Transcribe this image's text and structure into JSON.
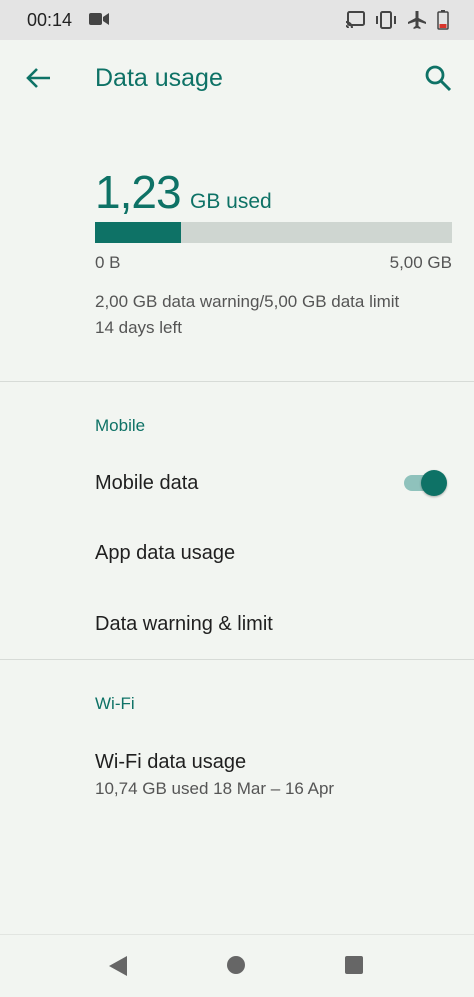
{
  "status_bar": {
    "time": "00:14",
    "icons": [
      "video-camera-icon",
      "cast-icon",
      "vibrate-icon",
      "airplane-icon",
      "battery-low-icon"
    ]
  },
  "app_bar": {
    "title": "Data usage",
    "back_icon": "arrow-back-icon",
    "search_icon": "search-icon"
  },
  "usage": {
    "amount": "1,23",
    "unit_label": "GB used",
    "bar_fraction": 0.24,
    "min_label": "0 B",
    "max_label": "5,00 GB",
    "warning_text": "2,00 GB data warning/5,00 GB data limit",
    "days_left": "14 days left"
  },
  "mobile": {
    "section_title": "Mobile",
    "mobile_data_label": "Mobile data",
    "mobile_data_enabled": true,
    "app_data_usage_label": "App data usage",
    "data_warning_limit_label": "Data warning & limit"
  },
  "wifi": {
    "section_title": "Wi-Fi",
    "wifi_usage_label": "Wi-Fi data usage",
    "wifi_usage_sub": "10,74 GB used 18 Mar – 16 Apr"
  },
  "nav_bar": {
    "icons": [
      "nav-back-icon",
      "nav-home-icon",
      "nav-recents-icon"
    ]
  },
  "colors": {
    "accent": "#0e7266",
    "background": "#f2f5f1",
    "bar_track": "#cfd6d1"
  }
}
